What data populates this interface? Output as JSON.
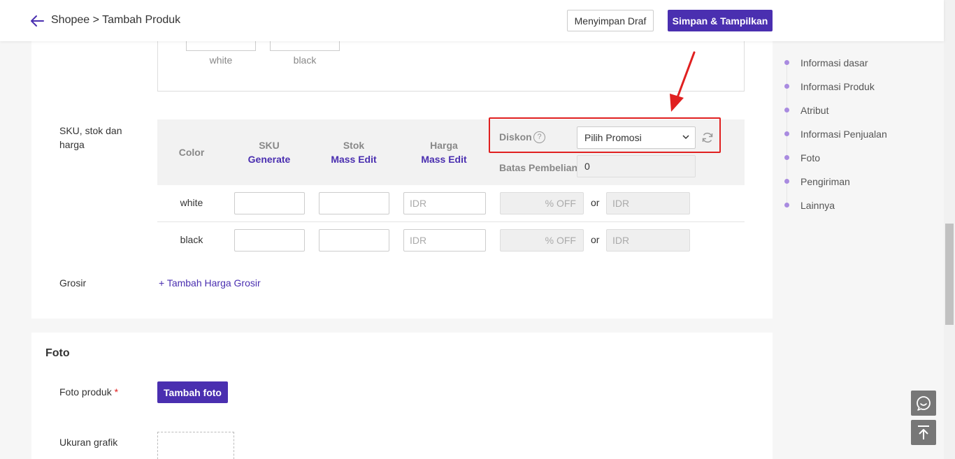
{
  "header": {
    "breadcrumb": "Shopee > Tambah Produk",
    "draft_label": "Menyimpan Draf",
    "save_label": "Simpan & Tampilkan"
  },
  "variants": {
    "items": [
      "white",
      "black"
    ]
  },
  "sku_section": {
    "label": "SKU, stok dan harga",
    "columns": {
      "color": "Color",
      "sku": "SKU",
      "sku_action": "Generate",
      "stok": "Stok",
      "stok_action": "Mass Edit",
      "harga": "Harga",
      "harga_action": "Mass Edit"
    },
    "diskon": {
      "label": "Diskon",
      "help": "?",
      "select_value": "Pilih Promosi"
    },
    "batas": {
      "label": "Batas Pembelian",
      "value": "0"
    },
    "rows": [
      {
        "name": "white",
        "harga_placeholder": "IDR",
        "off_placeholder": "% OFF",
        "or": "or",
        "idr_placeholder": "IDR"
      },
      {
        "name": "black",
        "harga_placeholder": "IDR",
        "off_placeholder": "% OFF",
        "or": "or",
        "idr_placeholder": "IDR"
      }
    ]
  },
  "grosir": {
    "label": "Grosir",
    "link": "+  Tambah Harga Grosir"
  },
  "foto": {
    "title": "Foto",
    "produk_label": "Foto produk",
    "required_mark": "*",
    "add_button": "Tambah foto",
    "ukuran_label": "Ukuran grafik"
  },
  "side_nav": {
    "items": [
      "Informasi dasar",
      "Informasi Produk",
      "Atribut",
      "Informasi Penjualan",
      "Foto",
      "Pengiriman",
      "Lainnya"
    ]
  },
  "colors": {
    "accent": "#4a2fb0",
    "highlight": "#e02020",
    "nav_dot": "#a98be0"
  }
}
